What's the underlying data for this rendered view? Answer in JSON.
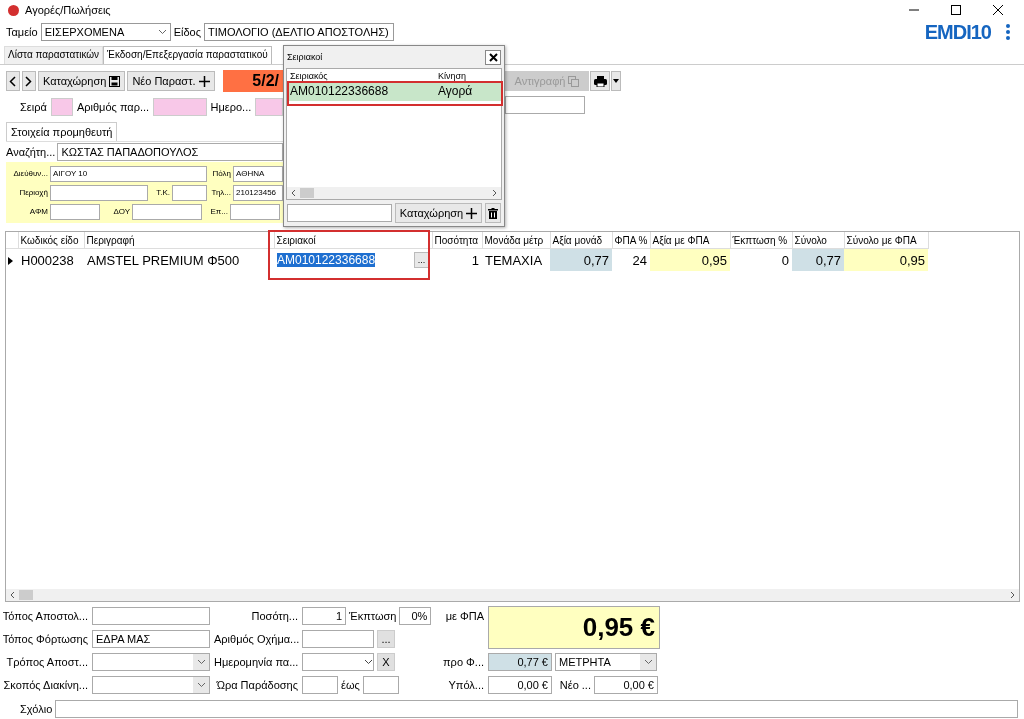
{
  "window": {
    "title": "Αγορές/Πωλήσεις"
  },
  "header": {
    "fields": [
      {
        "label": "Ταμείο",
        "value": "ΕΙΣΕΡΧΟΜΕΝΑ"
      },
      {
        "label": "Είδος",
        "value": "ΤΙΜΟΛΟΓΙΟ (ΔΕΛΤΙΟ ΑΠΟΣΤΟΛΗΣ)"
      }
    ],
    "logo": "EMDI10"
  },
  "tabs": [
    {
      "label": "Λίστα παραστατικών",
      "selected": false
    },
    {
      "label": "Έκδοση/Επεξεργασία παραστατικού",
      "selected": true
    }
  ],
  "toolbar": {
    "save": "Καταχώρηση",
    "new": "Νέο Παραστ.",
    "date": "5/2/",
    "copy": {
      "label": "Αντιγραφή",
      "disabled": true
    }
  },
  "doc_fields": [
    {
      "label": "Σειρά"
    },
    {
      "label": "Αριθμός παρ..."
    },
    {
      "label": "Ημερο..."
    }
  ],
  "supplier": {
    "tab": "Στοιχεία προμηθευτή",
    "search_label": "Αναζήτη...",
    "search_value": "ΚΩΣΤΑΣ ΠΑΠΑΔΟΠΟΥΛΟΣ",
    "address": {
      "label": "Διεύθυν...",
      "value": "ΑΙΓΟΥ 10"
    },
    "city": {
      "label": "Πόλη",
      "value": "ΑΘΗΝΑ"
    },
    "area": {
      "label": "Περιοχή"
    },
    "postcode": {
      "label": "Τ.Κ."
    },
    "phone": {
      "label": "Τηλ...",
      "value": "210123456"
    },
    "tax_id": {
      "label": "ΑΦΜ"
    },
    "tax_office": {
      "label": "ΔΟΥ"
    },
    "profession": {
      "label": "Επ..."
    }
  },
  "popup": {
    "title": "Σειριακοί",
    "columns": [
      "Σειριακός",
      "Κίνηση"
    ],
    "rows": [
      {
        "cells": [
          "AM010122336688",
          "Αγορά"
        ],
        "selected": true
      }
    ],
    "button": "Καταχώρηση"
  },
  "table": {
    "columns": [
      {
        "label": "Κωδικός είδο",
        "kind": "text"
      },
      {
        "label": "Περιγραφή",
        "kind": "text"
      },
      {
        "label": "Σειριακοί",
        "kind": "serial"
      },
      {
        "label": "Ποσότητα",
        "kind": "number"
      },
      {
        "label": "Μονάδα μέτρ",
        "kind": "text"
      },
      {
        "label": "Αξία μονάδ",
        "kind": "net"
      },
      {
        "label": "ΦΠΑ %",
        "kind": "number"
      },
      {
        "label": "Αξία με ΦΠΑ",
        "kind": "gross"
      },
      {
        "label": "Έκπτωση %",
        "kind": "number"
      },
      {
        "label": "Σύνολο",
        "kind": "net"
      },
      {
        "label": "Σύνολο με ΦΠΑ",
        "kind": "gross"
      }
    ],
    "rows": [
      {
        "current": true,
        "serial_button": "...",
        "cells": [
          "H000238",
          "AMSTEL PREMIUM Φ500",
          "AM010122336688",
          "1",
          "TEMAXIA",
          "0,77",
          "24",
          "0,95",
          "0",
          "0,77",
          "0,95"
        ]
      }
    ]
  },
  "footer": {
    "left": [
      {
        "label": "Τόπος Αποστολ...",
        "kind": "text"
      },
      {
        "label": "Τόπος Φόρτωσης",
        "kind": "text",
        "value": "ΕΔΡΑ ΜΑΣ"
      },
      {
        "label": "Τρόπος Αποστ...",
        "kind": "select"
      },
      {
        "label": "Σκοπός Διακίνη...",
        "kind": "select"
      }
    ],
    "quantity": {
      "label": "Ποσότη...",
      "value": "1"
    },
    "discount": {
      "label": "Έκπτωση",
      "value": "0%"
    },
    "vehicle": {
      "label": "Αριθμός Οχήμα...",
      "button": "..."
    },
    "date": {
      "label": "Ημερομηνία πα...",
      "button": "X"
    },
    "delivery_time": {
      "label": "Ώρα Παράδοσης",
      "to_label": "έως"
    },
    "total": {
      "label": "με ΦΠΑ",
      "value": "0,95 €"
    },
    "net": {
      "label": "προ Φ...",
      "value": "0,77 €"
    },
    "payment": {
      "value": "ΜΕΤΡΗΤΑ"
    },
    "balance": {
      "label": "Υπόλ...",
      "value": "0,00 €"
    },
    "new_balance": {
      "label": "Νέο ...",
      "value": "0,00 €"
    }
  },
  "comment": {
    "label": "Σχόλιο"
  }
}
